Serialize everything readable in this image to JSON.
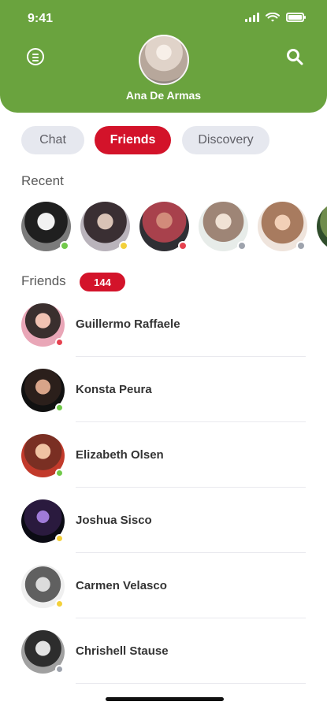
{
  "status_bar": {
    "time": "9:41"
  },
  "header": {
    "profile_name": "Ana De Armas"
  },
  "tabs": [
    {
      "label": "Chat",
      "active": false
    },
    {
      "label": "Friends",
      "active": true
    },
    {
      "label": "Discovery",
      "active": false
    }
  ],
  "recent": {
    "label": "Recent",
    "avatars": [
      {
        "status": "online"
      },
      {
        "status": "away"
      },
      {
        "status": "busy"
      },
      {
        "status": "offline"
      },
      {
        "status": "offline"
      },
      {
        "status": "online"
      }
    ]
  },
  "friends": {
    "label": "Friends",
    "count": "144",
    "items": [
      {
        "name": "Guillermo Raffaele",
        "status": "busy"
      },
      {
        "name": "Konsta Peura",
        "status": "online"
      },
      {
        "name": "Elizabeth Olsen",
        "status": "online"
      },
      {
        "name": "Joshua Sisco",
        "status": "away"
      },
      {
        "name": "Carmen Velasco",
        "status": "away"
      },
      {
        "name": "Chrishell Stause",
        "status": "offline"
      }
    ]
  },
  "icons": {
    "menu": "menu-icon",
    "search": "search-icon",
    "signal": "signal-icon",
    "wifi": "wifi-icon",
    "battery": "battery-icon"
  },
  "colors": {
    "brand_green": "#6aa33e",
    "accent_red": "#d3132a",
    "status_online": "#71c94a",
    "status_away": "#f3d03a",
    "status_busy": "#e6414f",
    "status_offline": "#9ea3ad"
  }
}
